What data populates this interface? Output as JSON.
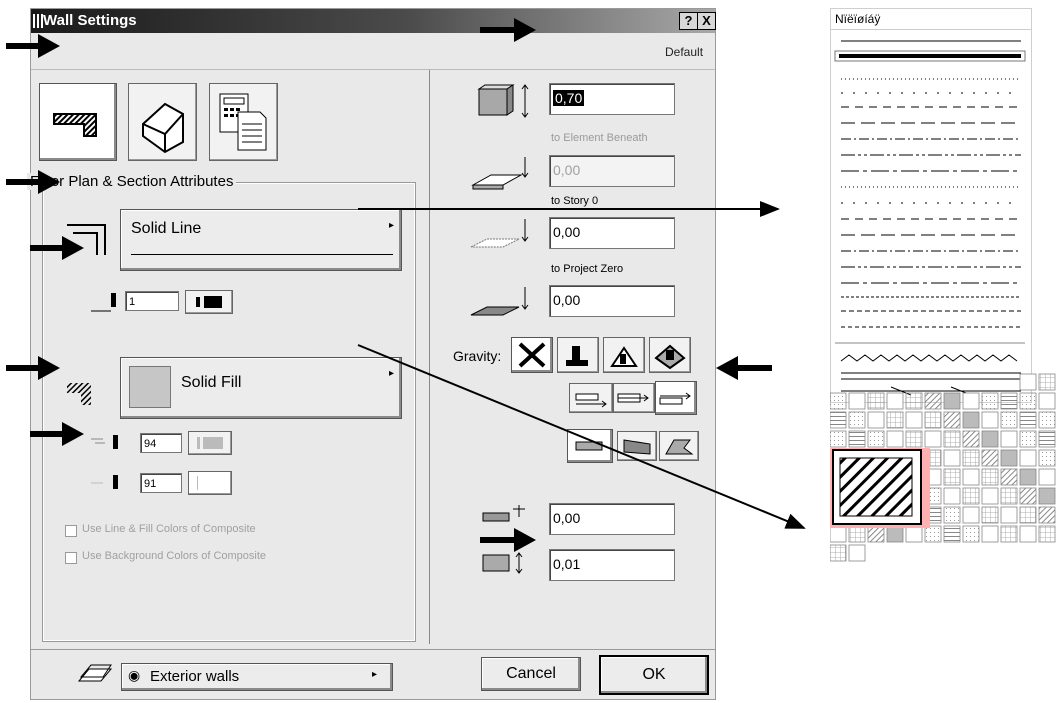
{
  "dialog": {
    "title": "Wall Settings",
    "help_label": "?",
    "close_label": "X",
    "default_label": "Default",
    "section_title": "Floor Plan & Section Attributes",
    "line_type": "Solid Line",
    "line_pen": "1",
    "fill_type": "Solid Fill",
    "fill_pen": "94",
    "bg_pen": "91",
    "check1_label": "Use Line & Fill Colors of Composite",
    "check2_label": "Use Background Colors of Composite",
    "layer_label": "Exterior walls",
    "cancel_label": "Cancel",
    "ok_label": "OK"
  },
  "geometry": {
    "height_value": "0,70",
    "height_note": "to Element Beneath",
    "base_story_value": "0,00",
    "base_story_note": "to Story 0",
    "base_project_value": "0,00",
    "base_project_note": "to Project Zero",
    "sea_value": "0,00",
    "gravity_label": "Gravity:",
    "offset_value": "0,00",
    "thickness_value": "0,01"
  },
  "line_panel": {
    "header": "Nïëïøíáÿ"
  },
  "colors": {
    "title_gradient_start": "#1a1a1a",
    "title_gradient_end": "#a8a8a8",
    "dialog_bg": "#e9e9e9",
    "selection": "#ffb0b0"
  },
  "icons": {
    "arrow": "arrow-right-icon",
    "arrow_left": "arrow-left-icon"
  }
}
